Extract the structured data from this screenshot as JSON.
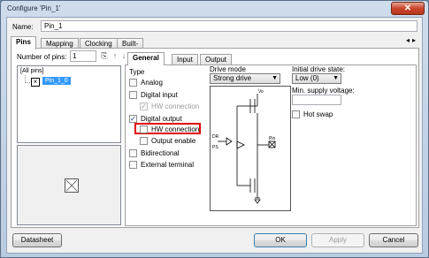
{
  "window": {
    "title": "Configure 'Pin_1'",
    "close_label": "✕"
  },
  "name": {
    "label": "Name:",
    "value": "Pin_1"
  },
  "tabs": [
    "Pins",
    "Mapping",
    "Clocking",
    "Built-in"
  ],
  "pins": {
    "count_label": "Number of pins:",
    "count_value": "1",
    "tree_root": "[All pins]",
    "selected_pin": "Pin_1_0"
  },
  "inner_tabs": [
    "General",
    "Input",
    "Output"
  ],
  "type_group": {
    "title": "Type",
    "analog": "Analog",
    "digital_input": "Digital input",
    "hw_connection_in": "HW connection",
    "digital_output": "Digital output",
    "hw_connection_out": "HW connection",
    "output_enable": "Output enable",
    "bidirectional": "Bidirectional",
    "external_terminal": "External terminal"
  },
  "drive_mode": {
    "label": "Drive mode",
    "value": "Strong drive"
  },
  "diagram": {
    "vdd": "Vo",
    "pin": "Pin",
    "dr": "DR",
    "ps": "PS"
  },
  "initial_state": {
    "label": "Initial drive state:",
    "value": "Low (0)"
  },
  "min_supply": {
    "label": "Min. supply voltage:",
    "value": ""
  },
  "hot_swap": {
    "label": "Hot swap"
  },
  "buttons": {
    "datasheet": "Datasheet",
    "ok": "OK",
    "apply": "Apply",
    "cancel": "Cancel"
  },
  "colors": {
    "highlight": "#e00000",
    "selection": "#3399ff"
  }
}
